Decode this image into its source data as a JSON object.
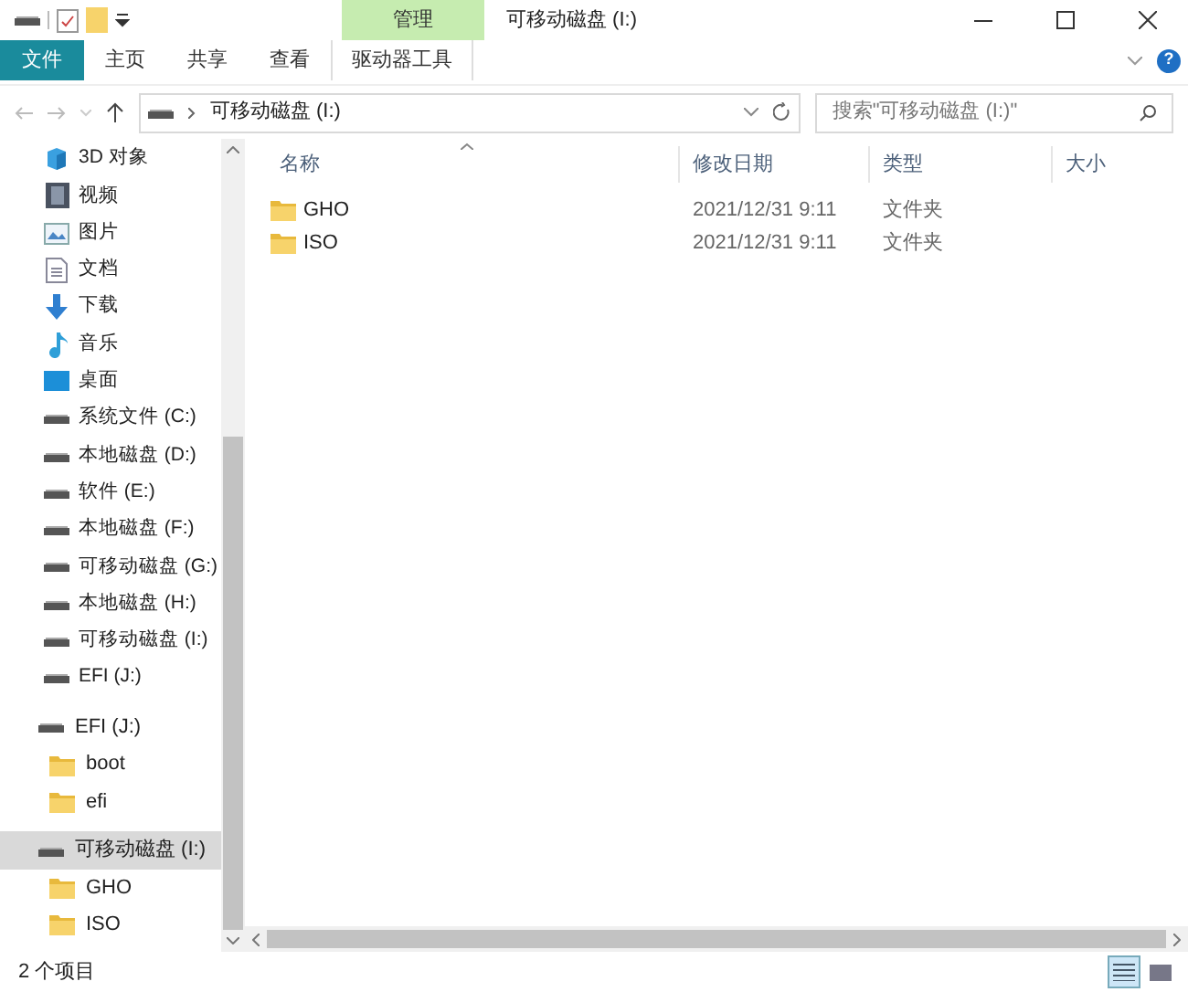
{
  "title_bar": {
    "context_tab": "管理",
    "title": "可移动磁盘 (I:)"
  },
  "ribbon_tabs": [
    {
      "label": "文件",
      "kind": "file"
    },
    {
      "label": "主页",
      "kind": "normal"
    },
    {
      "label": "共享",
      "kind": "normal"
    },
    {
      "label": "查看",
      "kind": "normal"
    },
    {
      "label": "驱动器工具",
      "kind": "context"
    }
  ],
  "help_button": "?",
  "address_bar": {
    "path": "可移动磁盘 (I:)",
    "search_placeholder": "搜索\"可移动磁盘 (I:)\""
  },
  "nav_items": [
    {
      "label": "3D 对象",
      "kind": "cube"
    },
    {
      "label": "视频",
      "kind": "video"
    },
    {
      "label": "图片",
      "kind": "picture"
    },
    {
      "label": "文档",
      "kind": "document"
    },
    {
      "label": "下载",
      "kind": "download"
    },
    {
      "label": "音乐",
      "kind": "music"
    },
    {
      "label": "桌面",
      "kind": "desktop"
    },
    {
      "label": "系统文件 (C:)",
      "kind": "drive"
    },
    {
      "label": "本地磁盘 (D:)",
      "kind": "drive"
    },
    {
      "label": "软件 (E:)",
      "kind": "drive"
    },
    {
      "label": "本地磁盘 (F:)",
      "kind": "drive"
    },
    {
      "label": "可移动磁盘 (G:)",
      "kind": "drive"
    },
    {
      "label": "本地磁盘 (H:)",
      "kind": "drive"
    },
    {
      "label": "可移动磁盘 (I:)",
      "kind": "drive"
    },
    {
      "label": "EFI (J:)",
      "kind": "drive"
    }
  ],
  "nav_drives": [
    {
      "label": "EFI (J:)",
      "selected": false,
      "children": [
        {
          "label": "boot",
          "selected": false
        },
        {
          "label": "efi",
          "selected": false
        }
      ]
    },
    {
      "label": "可移动磁盘 (I:)",
      "selected": true,
      "children": [
        {
          "label": "GHO",
          "selected": false
        },
        {
          "label": "ISO",
          "selected": false
        }
      ]
    }
  ],
  "columns": [
    "名称",
    "修改日期",
    "类型",
    "大小"
  ],
  "files": [
    {
      "name": "GHO",
      "modified": "2021/12/31 9:11",
      "type": "文件夹"
    },
    {
      "name": "ISO",
      "modified": "2021/12/31 9:11",
      "type": "文件夹"
    }
  ],
  "status_bar": {
    "item_count": "2 个项目"
  }
}
